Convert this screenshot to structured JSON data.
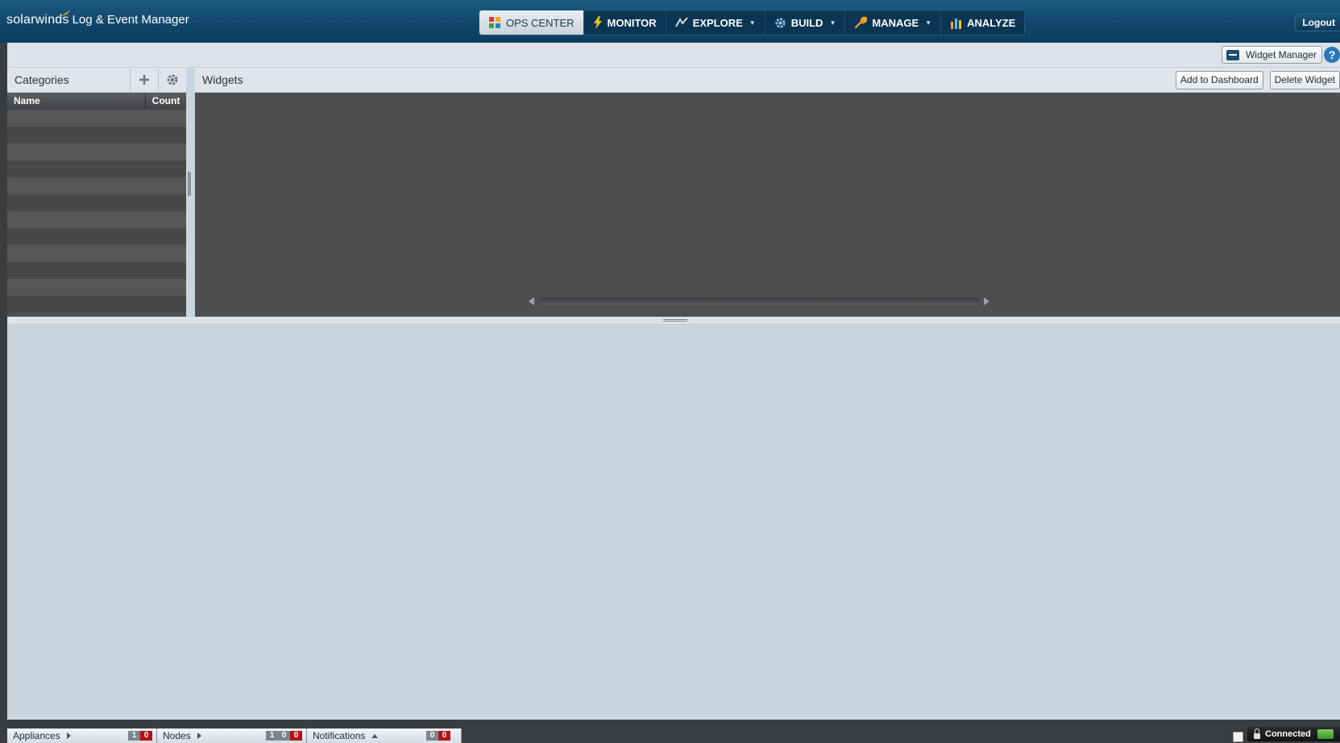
{
  "header": {
    "brand_name": "solarwinds",
    "product_name": "Log & Event Manager",
    "logout_label": "Logout"
  },
  "nav": {
    "items": [
      {
        "label": "OPS CENTER",
        "icon": "ops-center-icon",
        "active": true
      },
      {
        "label": "MONITOR",
        "icon": "lightning-icon"
      },
      {
        "label": "EXPLORE",
        "icon": "explore-icon",
        "has_menu": true
      },
      {
        "label": "BUILD",
        "icon": "gear-icon",
        "has_menu": true
      },
      {
        "label": "MANAGE",
        "icon": "wrench-icon",
        "has_menu": true
      },
      {
        "label": "ANALYZE",
        "icon": "bar-chart-icon"
      }
    ]
  },
  "toolbar": {
    "widget_manager_label": "Widget Manager",
    "help_label": "?"
  },
  "categories": {
    "title": "Categories",
    "columns": {
      "name": "Name",
      "count": "Count"
    },
    "rows": []
  },
  "widgets": {
    "title": "Widgets",
    "add_label": "Add to Dashboard",
    "delete_label": "Delete Widget"
  },
  "status": {
    "appliances": {
      "label": "Appliances",
      "counts": [
        "1",
        "0"
      ]
    },
    "nodes": {
      "label": "Nodes",
      "counts": [
        "1",
        "0",
        "0"
      ]
    },
    "notifications": {
      "label": "Notifications",
      "counts": [
        "0",
        "0"
      ]
    },
    "connection": "Connected"
  },
  "colors": {
    "header": "#0f4569",
    "panel_dark": "#4d4f51",
    "content_bg": "#c9d6e0",
    "alert_red": "#b31218",
    "accent_orange": "#f5a623"
  }
}
